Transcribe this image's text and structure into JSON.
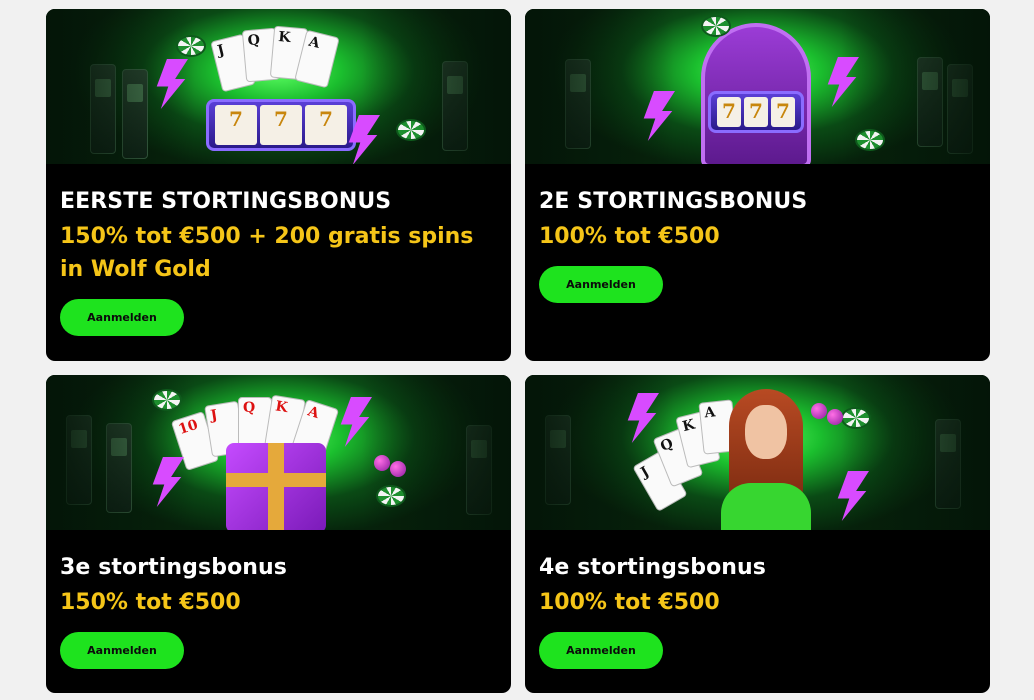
{
  "promotions": [
    {
      "title": "EERSTE STORTINGSBONUS",
      "offer": "150% tot €500 + 200 gratis spins in Wolf Gold",
      "button_label": "Aanmelden",
      "banner": {
        "reels": [
          "7",
          "7",
          "7"
        ],
        "cards": [
          "J",
          "Q",
          "K",
          "A"
        ]
      }
    },
    {
      "title": "2E STORTINGSBONUS",
      "offer": "100% tot €500",
      "button_label": "Aanmelden",
      "banner": {
        "reels": [
          "7",
          "7",
          "7"
        ]
      }
    },
    {
      "title": "3e stortingsbonus",
      "offer": "150% tot €500",
      "button_label": "Aanmelden",
      "banner": {
        "cards": [
          "10",
          "J",
          "Q",
          "K",
          "A"
        ]
      }
    },
    {
      "title": "4e stortingsbonus",
      "offer": "100% tot €500",
      "button_label": "Aanmelden",
      "banner": {
        "cards": [
          "J",
          "Q",
          "K",
          "A"
        ]
      }
    }
  ],
  "colors": {
    "page_background": "#f1f1f1",
    "card_background": "#000000",
    "title_text": "#ffffff",
    "offer_text": "#f5c518",
    "button_background": "#1ee31e",
    "button_text": "#0b0b0b",
    "accent_green": "#1bbf2e",
    "accent_purple": "#d84bff"
  },
  "icons": {
    "lightning": "lightning-bolt-icon",
    "chip": "casino-chip-icon",
    "cherry": "cherry-icon"
  }
}
